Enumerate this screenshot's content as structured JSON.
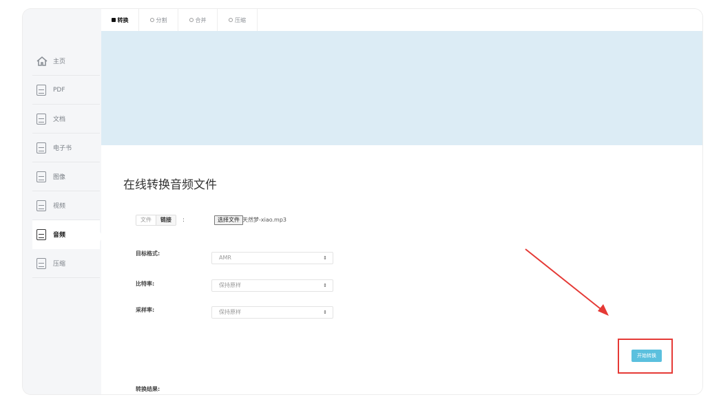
{
  "tabs": [
    {
      "label": "转换",
      "active": true
    },
    {
      "label": "分割",
      "active": false
    },
    {
      "label": "合并",
      "active": false
    },
    {
      "label": "压缩",
      "active": false
    }
  ],
  "sidebar": {
    "items": [
      {
        "label": "主页",
        "icon": "home-icon"
      },
      {
        "label": "PDF",
        "icon": "pdf-icon"
      },
      {
        "label": "文档",
        "icon": "word-doc-icon"
      },
      {
        "label": "电子书",
        "icon": "ebook-icon"
      },
      {
        "label": "图像",
        "icon": "image-icon"
      },
      {
        "label": "视频",
        "icon": "video-icon"
      },
      {
        "label": "音频",
        "icon": "audio-icon",
        "active": true
      },
      {
        "label": "压缩",
        "icon": "archive-icon"
      }
    ]
  },
  "main": {
    "title": "在线转换音频文件",
    "source_toggle": {
      "file": "文件",
      "link": "链接",
      "colon": ":"
    },
    "choose_file_label": "选择文件",
    "file_name": "天然梦-xiao.mp3",
    "target_format": {
      "label": "目标格式:",
      "value": "AMR"
    },
    "bitrate": {
      "label": "比特率:",
      "value": "保持原样"
    },
    "sample_rate": {
      "label": "采样率:",
      "value": "保持原样"
    },
    "start_button": "开始转换",
    "result_label": "转换结果:"
  },
  "colors": {
    "banner": "#dcecf5",
    "start_button": "#5bc0de",
    "annotation": "#e53935"
  }
}
